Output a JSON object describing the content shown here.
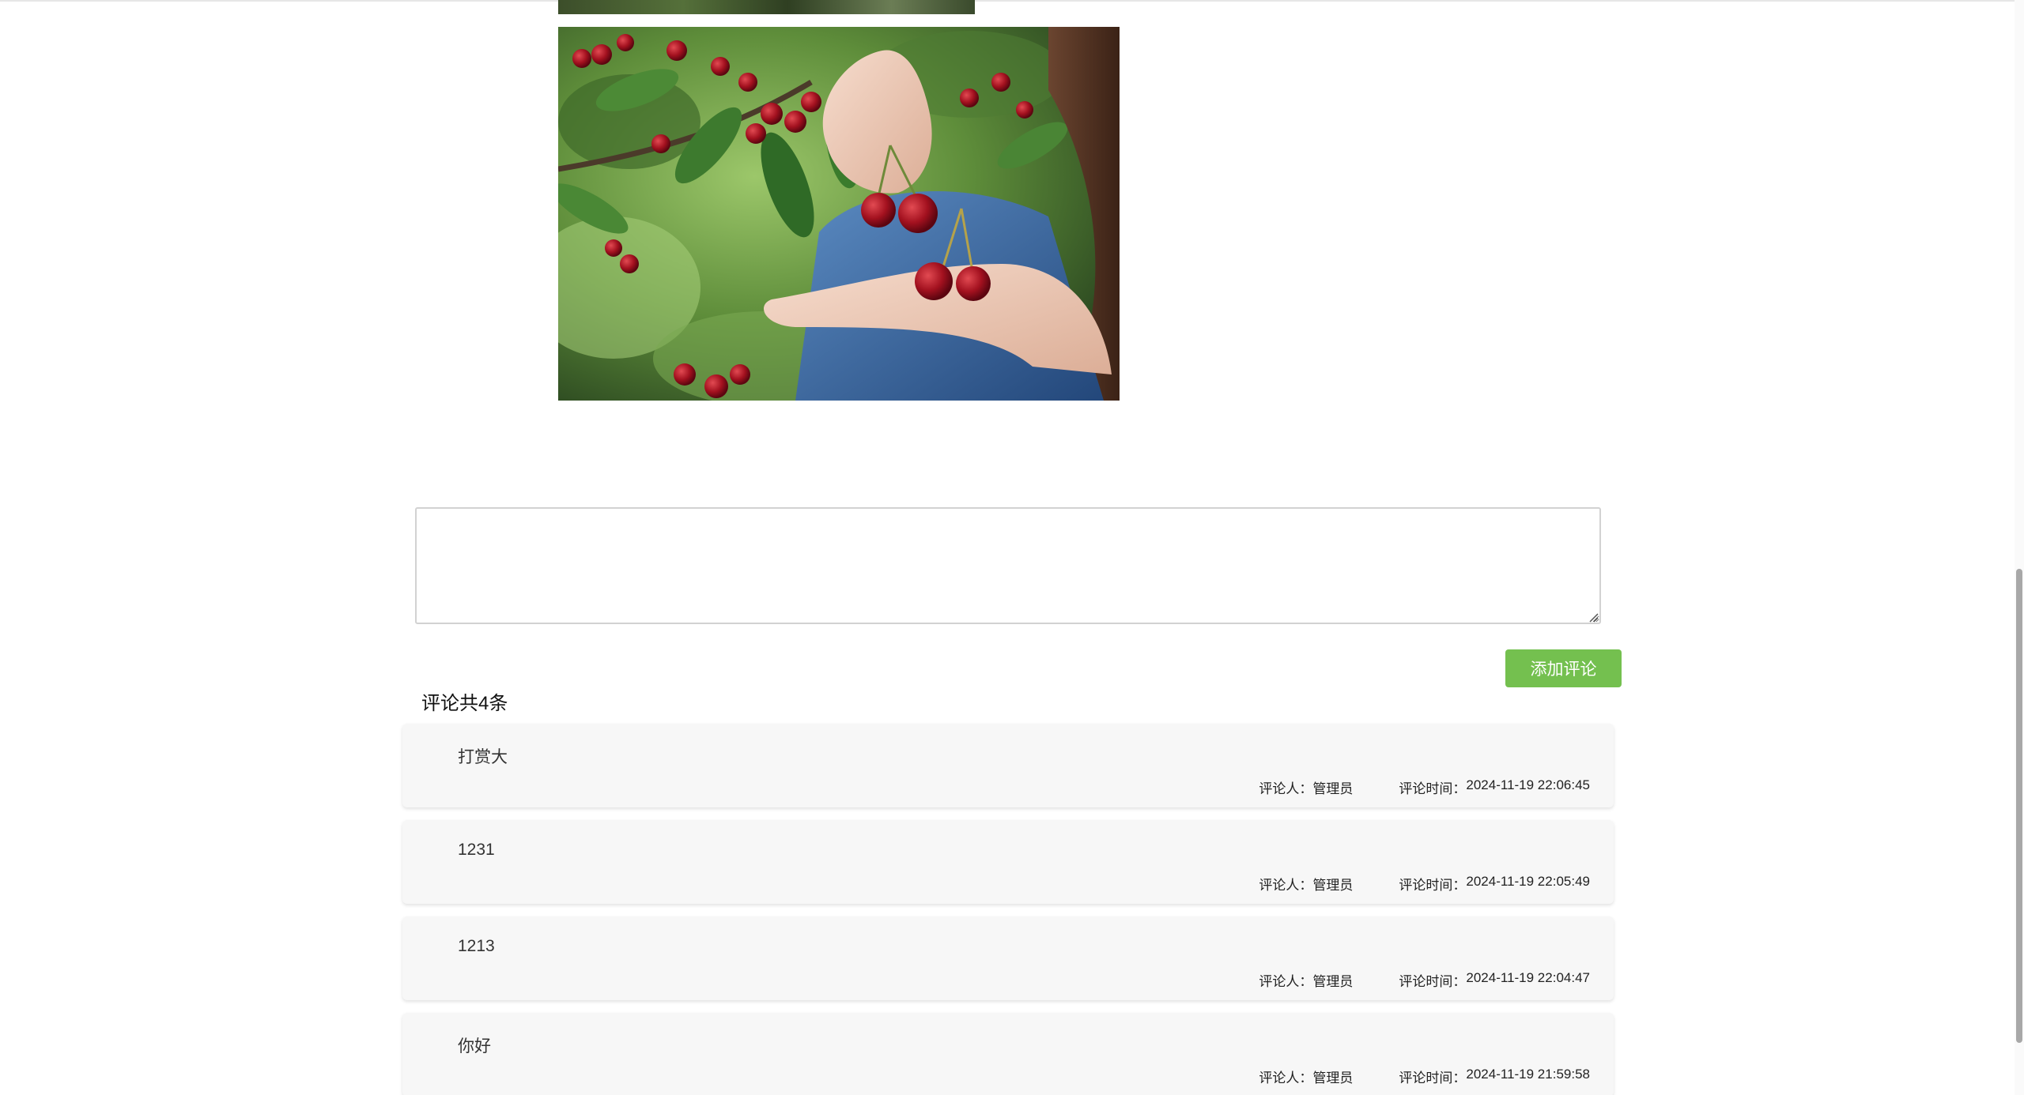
{
  "comment_input": {
    "value": "",
    "placeholder": ""
  },
  "add_button_label": "添加评论",
  "comment_count_label": "评论共4条",
  "comments": [
    {
      "text": "打赏大",
      "author_label": "评论人：",
      "author": "管理员",
      "time_label": "评论时间：",
      "time": "2024-11-19 22:06:45"
    },
    {
      "text": "1231",
      "author_label": "评论人：",
      "author": "管理员",
      "time_label": "评论时间：",
      "time": "2024-11-19 22:05:49"
    },
    {
      "text": "1213",
      "author_label": "评论人：",
      "author": "管理员",
      "time_label": "评论时间：",
      "time": "2024-11-19 22:04:47"
    },
    {
      "text": "你好",
      "author_label": "评论人：",
      "author": "管理员",
      "time_label": "评论时间：",
      "time": "2024-11-19 21:59:58"
    }
  ],
  "colors": {
    "accent": "#74c04f",
    "card_bg": "#f7f7f7"
  }
}
